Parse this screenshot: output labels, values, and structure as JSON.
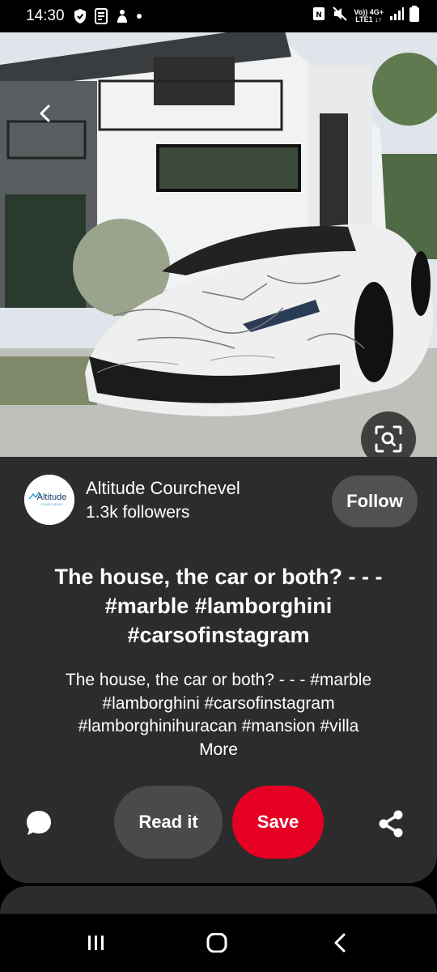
{
  "status_bar": {
    "time": "14:30",
    "network_top": "Vo)) 4G+",
    "network_bottom": "LTE1 ↓↑",
    "icons": [
      "shield-icon",
      "sim-toolkit-icon",
      "notification-icon",
      "dot-icon",
      "nfc-icon",
      "mute-icon",
      "signal-icon",
      "battery-icon"
    ]
  },
  "pin": {
    "image_alt": "White marble-wrapped Lamborghini in front of a modern white mansion",
    "profile": {
      "name": "Altitude Courchevel",
      "followers": "1.3k followers",
      "avatar_text": "Altitude",
      "avatar_subtext": "COURCHEVEL"
    },
    "follow_label": "Follow",
    "title": "The house, the car or both? - - - #marble #lamborghini #carsofinstagram",
    "description": "The house, the car or both? - - - #marble #lamborghini #carsofinstagram #lamborghinihuracan #mansion #villa",
    "more_label": "More",
    "read_label": "Read it",
    "save_label": "Save"
  },
  "colors": {
    "card_bg": "#2c2c2c",
    "save_red": "#e60023",
    "button_gray": "#4a4a4a"
  }
}
